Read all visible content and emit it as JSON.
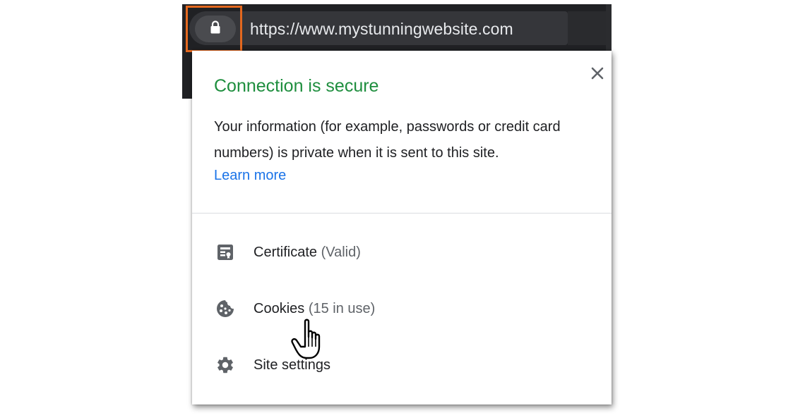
{
  "browser": {
    "url": "https://www.mystunningwebsite.com"
  },
  "popup": {
    "title": "Connection is secure",
    "description": "Your information (for example, passwords or credit card numbers) is private when it is sent to this site.",
    "learn_more": "Learn more",
    "items": [
      {
        "label": "Certificate",
        "sub": "(Valid)",
        "icon": "certificate-icon"
      },
      {
        "label": "Cookies",
        "sub": "(15 in use)",
        "icon": "cookie-icon"
      },
      {
        "label": "Site settings",
        "sub": "",
        "icon": "gear-icon"
      }
    ]
  },
  "colors": {
    "secure_green": "#1e8e3e",
    "link_blue": "#1a73e8",
    "highlight_orange": "#e4681e",
    "chrome_dark": "#202124"
  }
}
